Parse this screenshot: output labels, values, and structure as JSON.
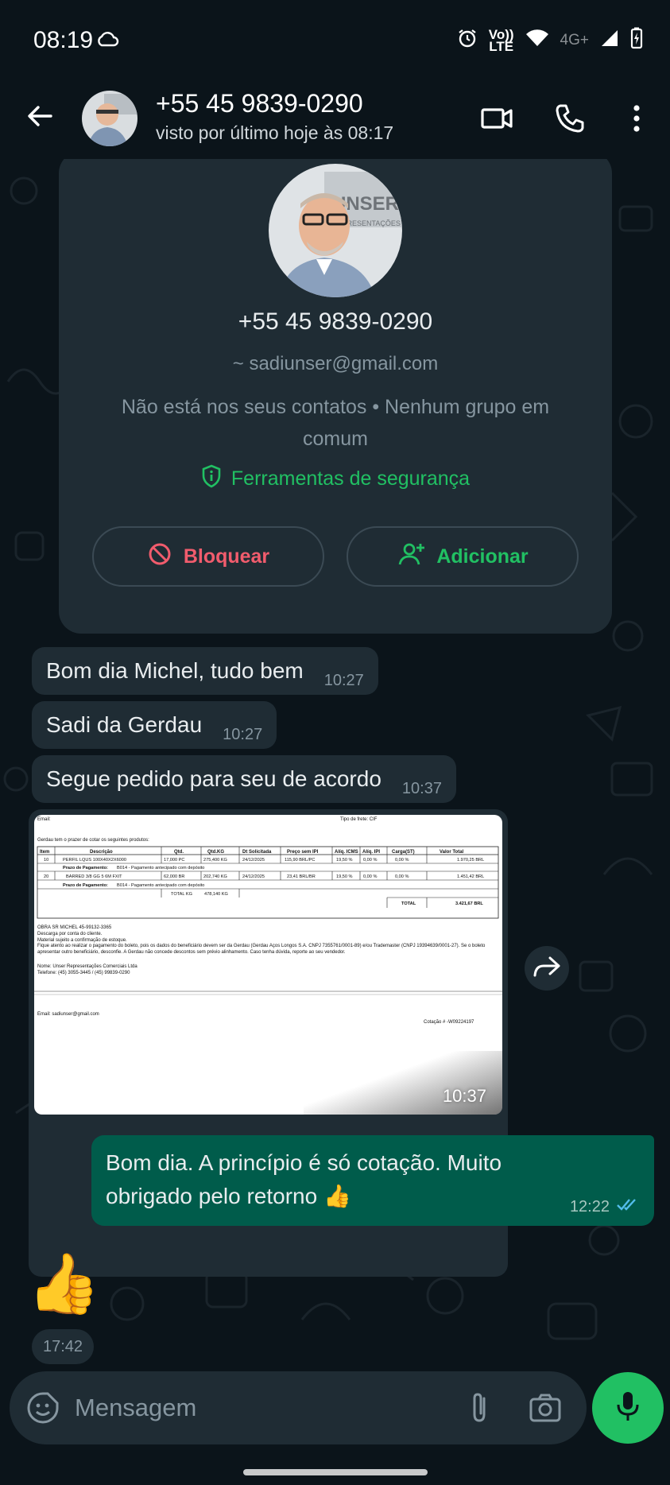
{
  "status_bar": {
    "time": "08:19",
    "volte_top": "Vo))",
    "volte_bottom": "LTE",
    "network": "4G+",
    "icons": [
      "cloud-icon",
      "alarm-icon",
      "wifi-icon",
      "signal-icon",
      "battery-charging-icon"
    ]
  },
  "header": {
    "contact_name": "+55 45 9839-0290",
    "last_seen": "visto por último hoje às 08:17",
    "icons": [
      "back-arrow-icon",
      "video-call-icon",
      "phone-call-icon",
      "more-vert-icon"
    ]
  },
  "profile_card": {
    "name": "+55 45 9839-0290",
    "email": "~ sadiunser@gmail.com",
    "note": "Não está nos seus contatos • Nenhum grupo em comum",
    "security_label": "Ferramentas de segurança",
    "block_label": "Bloquear",
    "add_label": "Adicionar",
    "avatar_brand_text": "UNSER",
    "avatar_brand_sub": "REPRESENTAÇÕES"
  },
  "messages": [
    {
      "text": "Bom dia Michel,  tudo bem",
      "time": "10:27",
      "direction": "in"
    },
    {
      "text": "Sadi da Gerdau",
      "time": "10:27",
      "direction": "in"
    },
    {
      "text": "Segue pedido para seu de acordo",
      "time": "10:37",
      "direction": "in"
    },
    {
      "text": "Bom dia. A princípio é só cotação. Muito obrigado pelo retorno 👍",
      "time": "12:22",
      "direction": "out",
      "status": "read"
    },
    {
      "text": "👍",
      "time": "17:42",
      "direction": "in"
    }
  ],
  "image_message": {
    "time": "10:37",
    "doc": {
      "header_left": "Email:",
      "header_right": "Tipo de frete: CIF",
      "intro": "Gerdau tem o prazer de cotar os seguintes produtos:",
      "columns": [
        "Item",
        "Descrição",
        "Qtd.",
        "Qtd.KG",
        "Dt Solicitada",
        "Preço sem IPI",
        "Alíq. ICMS",
        "Alíq. IPI",
        "Carga(ST)",
        "Valor Total"
      ],
      "rows": [
        [
          "10",
          "PERFIL LQUS 100X40X2X6000",
          "17,000 PC",
          "275,400 KG",
          "24/12/2025",
          "115,90 BRL/PC",
          "19,50 %",
          "0,00 %",
          "0,00 %",
          "1.970,25 BRL"
        ],
        [
          "20",
          "BARRED 3/8 GG 5 6M FXIT",
          "62,000 BR",
          "202,740 KG",
          "24/12/2025",
          "23,41 BRL/BR",
          "19,50 %",
          "0,00 %",
          "0,00 %",
          "1.451,42 BRL"
        ]
      ],
      "payment_label": "Prazo de Pagamento:",
      "payment_value": "B014 - Pagamento antecipado com depósito",
      "total_kg_label": "TOTAL KG",
      "total_kg": "478,140 KG",
      "total_label": "TOTAL",
      "total_value": "3.421,67 BRL",
      "obra": "OBRA SR MICHEL 45-99132-3365",
      "notes": [
        "Descarga por conta do cliente.",
        "Material sujeito a confirmação de estoque.",
        "Fique atento ao realizar o pagamento do boleto, pois os dados do beneficiário devem ser da Gerdau (Gerdau Aços Longos S.A. CNPJ 7355761/0001-89) e/ou Trademaster (CNPJ 19394639/0001-27). Se o boleto apresentar outro beneficiário, desconfie. A Gerdau não concede descontos sem prévio alinhamento. Caso tenha dúvida, reporte ao seu vendedor."
      ],
      "name_line": "Nome: Unser Representações Comerciais Ltda",
      "phone_line": "Telefone: (45) 3055-3445 / (45) 99839-0290",
      "email_line": "Email: sadiunser@gmail.com",
      "cotacao": "Cotação # -W09224197"
    }
  },
  "input_bar": {
    "placeholder": "Mensagem",
    "icons": [
      "emoji-sticker-icon",
      "attach-clip-icon",
      "camera-icon",
      "mic-icon"
    ]
  },
  "colors": {
    "background": "#0b141a",
    "incoming_bubble": "#1f2c34",
    "outgoing_bubble": "#005c4b",
    "accent_green": "#21c063",
    "danger_red": "#f15c6d",
    "read_ticks": "#53bdeb"
  }
}
